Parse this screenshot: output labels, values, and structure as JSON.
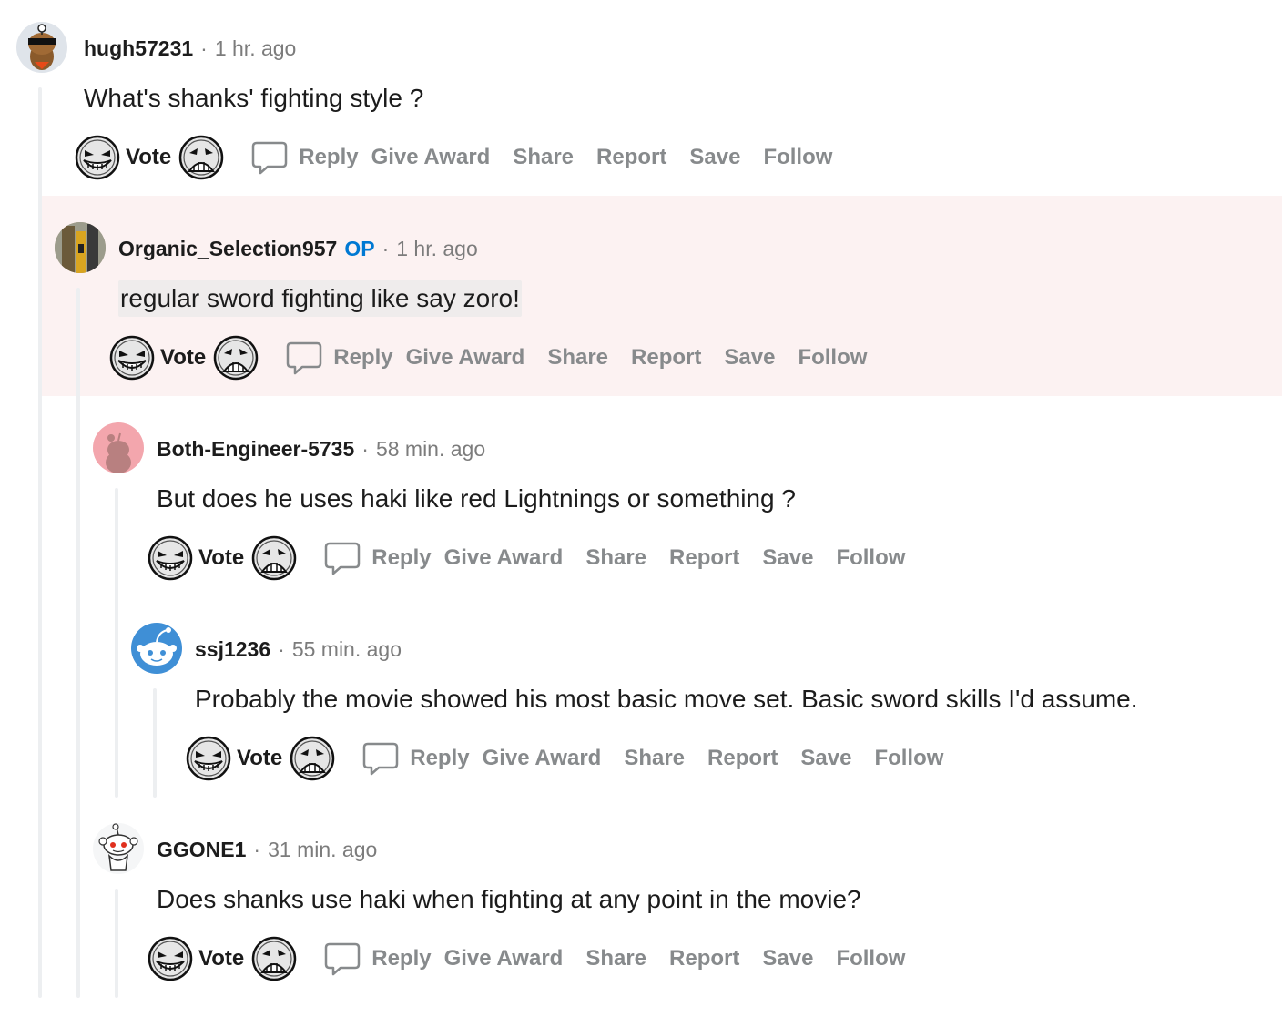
{
  "comments": [
    {
      "username": "hugh57231",
      "is_op": false,
      "time": "1 hr. ago",
      "body": "What's shanks' fighting style ?",
      "avatar": "sunglasses-snoo-avatar"
    },
    {
      "username": "Organic_Selection957",
      "is_op": true,
      "op_label": "OP",
      "time": "1 hr. ago",
      "body": "regular sword fighting like say zoro!",
      "avatar": "photo-avatar",
      "highlighted": true
    },
    {
      "username": "Both-Engineer-5735",
      "is_op": false,
      "time": "58 min. ago",
      "body": "But does he uses haki like red Lightnings or something ?",
      "avatar": "pink-snoo-avatar"
    },
    {
      "username": "ssj1236",
      "is_op": false,
      "time": "55 min. ago",
      "body": "Probably the movie showed his most basic move set. Basic sword skills I'd assume.",
      "avatar": "blue-snoo-avatar"
    },
    {
      "username": "GGONE1",
      "is_op": false,
      "time": "31 min. ago",
      "body": "Does shanks use haki when fighting at any point in the movie?",
      "avatar": "white-snoo-avatar"
    }
  ],
  "separator": "·",
  "actions": {
    "vote": "Vote",
    "reply": "Reply",
    "give_award": "Give Award",
    "share": "Share",
    "report": "Report",
    "save": "Save",
    "follow": "Follow"
  },
  "icons": {
    "upvote": "grinning-face-upvote-icon",
    "downvote": "frowning-face-downvote-icon",
    "reply": "speech-bubble-icon"
  },
  "colors": {
    "op": "#0079d3",
    "highlight": "#fcf2f2",
    "thread_line": "#edeff1",
    "muted": "#878a8c"
  }
}
